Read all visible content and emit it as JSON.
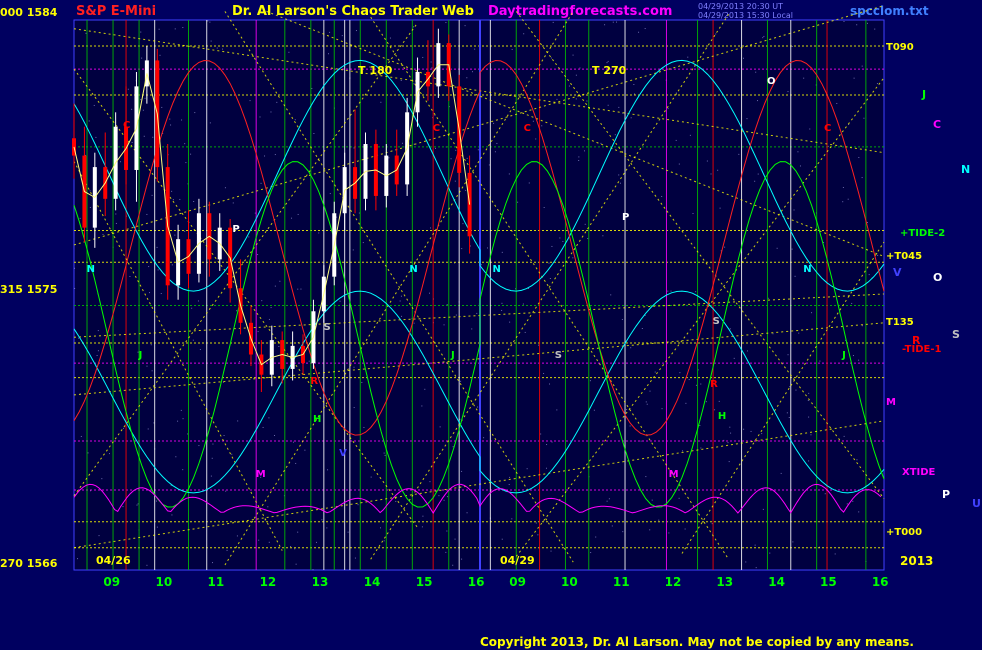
{
  "header": {
    "instrument": "S&P E-Mini",
    "site": "Dr. Al Larson's Chaos Trader Web",
    "url": "Daytradingforecasts.com",
    "timestamp_1": "04/29/2013 20:30 UT",
    "timestamp_2": "04/29/2013 15:30 Local",
    "file": "spcclom.txt"
  },
  "footer": {
    "copyright": "Copyright 2013, Dr. Al Larson. May not be copied by any means."
  },
  "price_labels": {
    "top": "000  1584",
    "mid": "315  1575",
    "bottom": "270  1566"
  },
  "colors": {
    "background": "#000060",
    "plot_background": "#000040",
    "grid_green": "#00c000",
    "yellow": "#ffff00",
    "red": "#ff0000",
    "cyan": "#00ffff",
    "green": "#00ff00",
    "magenta": "#ff00ff",
    "white": "#ffffff"
  },
  "chart_data": {
    "type": "candlestick",
    "title": "S&P E-Mini",
    "yrange": [
      1566,
      1584
    ],
    "y_ticks": [
      1584,
      1575,
      1566
    ],
    "date_markers": [
      "04/26",
      "04/29"
    ],
    "x_ticks": [
      "09",
      "10",
      "11",
      "12",
      "13",
      "14",
      "15",
      "16",
      "09",
      "10",
      "11",
      "12",
      "13",
      "14",
      "15",
      "16"
    ],
    "year": "2013",
    "top_labels": [
      {
        "text": "T  180"
      },
      {
        "text": "T  270"
      }
    ],
    "right_labels": [
      {
        "text": "T090",
        "color": "#ffff00"
      },
      {
        "text": "+TIDE-2",
        "color": "#00ff00"
      },
      {
        "text": "+T045",
        "color": "#ffff00"
      },
      {
        "text": "T135",
        "color": "#ffff00"
      },
      {
        "text": "-TIDE-1",
        "color": "#ff0000"
      },
      {
        "text": "M",
        "color": "#ff00ff"
      },
      {
        "text": "XTIDE",
        "color": "#ff00ff"
      },
      {
        "text": "+T000",
        "color": "#ffff00"
      }
    ],
    "planet_legend": [
      {
        "text": "J",
        "color": "#00ff00"
      },
      {
        "text": "C",
        "color": "#ff00ff"
      },
      {
        "text": "N",
        "color": "#00ffff"
      },
      {
        "text": "V",
        "color": "#4040ff"
      },
      {
        "text": "O",
        "color": "#ffffff"
      },
      {
        "text": "S",
        "color": "#c0c0c0"
      },
      {
        "text": "R",
        "color": "#ff0000"
      },
      {
        "text": "P",
        "color": "#ffffff"
      },
      {
        "text": "U",
        "color": "#4040ff"
      }
    ],
    "inplot_markers": [
      {
        "text": "C",
        "color": "#ff0000",
        "day": 1,
        "hour": 9.3,
        "price": 1581.2
      },
      {
        "text": "N",
        "color": "#00ffff",
        "day": 1,
        "hour": 8.6,
        "price": 1576.2
      },
      {
        "text": "P",
        "color": "#ffffff",
        "day": 1,
        "hour": 11.4,
        "price": 1577.6
      },
      {
        "text": "J",
        "color": "#00ff00",
        "day": 1,
        "hour": 9.6,
        "price": 1573.2
      },
      {
        "text": "S",
        "color": "#c0c0c0",
        "day": 1,
        "hour": 13.15,
        "price": 1574.2
      },
      {
        "text": "R",
        "color": "#ff0000",
        "day": 1,
        "hour": 12.9,
        "price": 1572.3
      },
      {
        "text": "H",
        "color": "#00ff00",
        "day": 1,
        "hour": 12.95,
        "price": 1571.0
      },
      {
        "text": "V",
        "color": "#4040ff",
        "day": 1,
        "hour": 13.45,
        "price": 1569.8
      },
      {
        "text": "M",
        "color": "#ff00ff",
        "day": 1,
        "hour": 11.85,
        "price": 1569.1
      },
      {
        "text": "N",
        "color": "#00ffff",
        "day": 1,
        "hour": 14.8,
        "price": 1576.2
      },
      {
        "text": "C",
        "color": "#ff0000",
        "day": 1,
        "hour": 15.25,
        "price": 1581.1
      },
      {
        "text": "J",
        "color": "#00ff00",
        "day": 1,
        "hour": 15.6,
        "price": 1573.2
      },
      {
        "text": "N",
        "color": "#00ffff",
        "day": 2,
        "hour": 8.6,
        "price": 1576.2
      },
      {
        "text": "C",
        "color": "#ff0000",
        "day": 2,
        "hour": 9.2,
        "price": 1581.1
      },
      {
        "text": "P",
        "color": "#ffffff",
        "day": 2,
        "hour": 11.1,
        "price": 1578.0
      },
      {
        "text": "S",
        "color": "#c0c0c0",
        "day": 2,
        "hour": 9.8,
        "price": 1573.2
      },
      {
        "text": "O",
        "color": "#ffffff",
        "day": 2,
        "hour": 13.9,
        "price": 1582.7
      },
      {
        "text": "S",
        "color": "#c0c0c0",
        "day": 2,
        "hour": 12.85,
        "price": 1574.4
      },
      {
        "text": "R",
        "color": "#ff0000",
        "day": 2,
        "hour": 12.8,
        "price": 1572.2
      },
      {
        "text": "H",
        "color": "#00ff00",
        "day": 2,
        "hour": 12.95,
        "price": 1571.1
      },
      {
        "text": "M",
        "color": "#ff00ff",
        "day": 2,
        "hour": 12.0,
        "price": 1569.1
      },
      {
        "text": "N",
        "color": "#00ffff",
        "day": 2,
        "hour": 14.6,
        "price": 1576.2
      },
      {
        "text": "C",
        "color": "#ff0000",
        "day": 2,
        "hour": 15.0,
        "price": 1581.1
      },
      {
        "text": "J",
        "color": "#00ff00",
        "day": 2,
        "hour": 15.35,
        "price": 1573.2
      }
    ],
    "vertical_lines": [
      {
        "day": 1,
        "hour": 8.55,
        "color": "#00c000"
      },
      {
        "day": 1,
        "hour": 9.05,
        "color": "#00c000"
      },
      {
        "day": 1,
        "hour": 9.3,
        "color": "#ff0000"
      },
      {
        "day": 1,
        "hour": 9.55,
        "color": "#00c000"
      },
      {
        "day": 1,
        "hour": 9.85,
        "color": "#ffffff"
      },
      {
        "day": 1,
        "hour": 10.5,
        "color": "#00c000"
      },
      {
        "day": 1,
        "hour": 10.85,
        "color": "#ffffff"
      },
      {
        "day": 1,
        "hour": 11.8,
        "color": "#ff00ff"
      },
      {
        "day": 1,
        "hour": 12.35,
        "color": "#00c000"
      },
      {
        "day": 1,
        "hour": 12.85,
        "color": "#00c000"
      },
      {
        "day": 1,
        "hour": 13.1,
        "color": "#ffffff"
      },
      {
        "day": 1,
        "hour": 13.3,
        "color": "#00c000"
      },
      {
        "day": 1,
        "hour": 13.5,
        "color": "#ffffff"
      },
      {
        "day": 1,
        "hour": 13.6,
        "color": "#ffffff"
      },
      {
        "day": 1,
        "hour": 13.8,
        "color": "#00c000"
      },
      {
        "day": 1,
        "hour": 14.3,
        "color": "#00c000"
      },
      {
        "day": 1,
        "hour": 14.8,
        "color": "#00c000"
      },
      {
        "day": 1,
        "hour": 15.2,
        "color": "#ff0000"
      },
      {
        "day": 1,
        "hour": 15.5,
        "color": "#00c000"
      },
      {
        "day": 1,
        "hour": 15.7,
        "color": "#ffffff"
      },
      {
        "day": 2,
        "hour": 8.5,
        "color": "#ffffff"
      },
      {
        "day": 2,
        "hour": 9.0,
        "color": "#00c000"
      },
      {
        "day": 2,
        "hour": 9.45,
        "color": "#ff0000"
      },
      {
        "day": 2,
        "hour": 9.95,
        "color": "#00c000"
      },
      {
        "day": 2,
        "hour": 10.4,
        "color": "#00c000"
      },
      {
        "day": 2,
        "hour": 11.1,
        "color": "#ffffff"
      },
      {
        "day": 2,
        "hour": 11.9,
        "color": "#ff00ff"
      },
      {
        "day": 2,
        "hour": 12.5,
        "color": "#00c000"
      },
      {
        "day": 2,
        "hour": 12.8,
        "color": "#ff0000"
      },
      {
        "day": 2,
        "hour": 13.35,
        "color": "#ffffff"
      },
      {
        "day": 2,
        "hour": 13.85,
        "color": "#00c000"
      },
      {
        "day": 2,
        "hour": 14.3,
        "color": "#ffffff"
      },
      {
        "day": 2,
        "hour": 14.8,
        "color": "#00c000"
      },
      {
        "day": 2,
        "hour": 15.0,
        "color": "#ff0000"
      },
      {
        "day": 2,
        "hour": 15.75,
        "color": "#00c000"
      }
    ],
    "horizontal_lines": [
      {
        "price": 1584.0,
        "color": "#ffff00"
      },
      {
        "price": 1583.2,
        "color": "#ff00ff"
      },
      {
        "price": 1582.3,
        "color": "#ffff00"
      },
      {
        "price": 1580.5,
        "color": "#00c000"
      },
      {
        "price": 1577.6,
        "color": "#ffff00"
      },
      {
        "price": 1576.5,
        "color": "#ffff00"
      },
      {
        "price": 1575.0,
        "color": "#00c000"
      },
      {
        "price": 1573.7,
        "color": "#ffff00"
      },
      {
        "price": 1573.0,
        "color": "#ff00ff"
      },
      {
        "price": 1572.5,
        "color": "#ffff00"
      },
      {
        "price": 1570.3,
        "color": "#ff00ff"
      },
      {
        "price": 1568.6,
        "color": "#ff00ff"
      },
      {
        "price": 1567.5,
        "color": "#ffff00"
      },
      {
        "price": 1566.6,
        "color": "#ffff00"
      }
    ],
    "diagonals": [
      {
        "from": [
          1,
          8.3,
          1584.6
        ],
        "to": [
          2,
          16.1,
          1580.3
        ]
      },
      {
        "from": [
          1,
          8.3,
          1577.1
        ],
        "to": [
          2,
          16.1,
          1585.4
        ]
      },
      {
        "from": [
          1,
          8.3,
          1583.2
        ],
        "to": [
          1,
          14.9,
          1567.3
        ]
      },
      {
        "from": [
          1,
          8.3,
          1568.4
        ],
        "to": [
          1,
          14.9,
          1584.8
        ]
      },
      {
        "from": [
          1,
          11.2,
          1585.2
        ],
        "to": [
          2,
          10.1,
          1566.1
        ]
      },
      {
        "from": [
          1,
          11.2,
          1566.0
        ],
        "to": [
          2,
          10.1,
          1585.2
        ]
      },
      {
        "from": [
          1,
          14.0,
          1585.0
        ],
        "to": [
          2,
          13.1,
          1566.2
        ]
      },
      {
        "from": [
          1,
          14.0,
          1566.2
        ],
        "to": [
          2,
          13.1,
          1585.1
        ]
      },
      {
        "from": [
          2,
          9.0,
          1585.2
        ],
        "to": [
          2,
          16.1,
          1568.3
        ]
      },
      {
        "from": [
          2,
          9.0,
          1566.3
        ],
        "to": [
          2,
          16.1,
          1582.9
        ]
      },
      {
        "from": [
          1,
          8.3,
          1573.9
        ],
        "to": [
          2,
          16.1,
          1575.4
        ]
      },
      {
        "from": [
          1,
          8.3,
          1571.9
        ],
        "to": [
          2,
          16.1,
          1574.4
        ]
      },
      {
        "from": [
          1,
          8.3,
          1580.0
        ],
        "to": [
          1,
          12.3,
          1566.5
        ]
      },
      {
        "from": [
          1,
          12.0,
          1585.2
        ],
        "to": [
          2,
          16.1,
          1576.7
        ]
      },
      {
        "from": [
          1,
          8.3,
          1566.6
        ],
        "to": [
          2,
          16.1,
          1571.0
        ]
      },
      {
        "from": [
          2,
          12.2,
          1566.4
        ],
        "to": [
          2,
          16.1,
          1577.2
        ]
      }
    ],
    "price_series": [
      {
        "day": 1,
        "hour": 8.3,
        "o": 1580.8,
        "h": 1582.0,
        "l": 1579.4,
        "c": 1580.2
      },
      {
        "day": 1,
        "hour": 8.5,
        "o": 1580.2,
        "h": 1581.2,
        "l": 1577.2,
        "c": 1577.7
      },
      {
        "day": 1,
        "hour": 8.7,
        "o": 1577.7,
        "h": 1580.3,
        "l": 1577.0,
        "c": 1579.8
      },
      {
        "day": 1,
        "hour": 8.9,
        "o": 1579.8,
        "h": 1581.0,
        "l": 1578.1,
        "c": 1578.7
      },
      {
        "day": 1,
        "hour": 9.1,
        "o": 1578.7,
        "h": 1581.7,
        "l": 1578.3,
        "c": 1581.2
      },
      {
        "day": 1,
        "hour": 9.3,
        "o": 1581.2,
        "h": 1582.6,
        "l": 1579.2,
        "c": 1579.7
      },
      {
        "day": 1,
        "hour": 9.5,
        "o": 1579.7,
        "h": 1583.1,
        "l": 1578.6,
        "c": 1582.6
      },
      {
        "day": 1,
        "hour": 9.7,
        "o": 1582.6,
        "h": 1584.0,
        "l": 1582.0,
        "c": 1583.5
      },
      {
        "day": 1,
        "hour": 9.9,
        "o": 1583.5,
        "h": 1583.9,
        "l": 1579.3,
        "c": 1579.8
      },
      {
        "day": 1,
        "hour": 10.1,
        "o": 1579.8,
        "h": 1580.6,
        "l": 1575.2,
        "c": 1575.7
      },
      {
        "day": 1,
        "hour": 10.3,
        "o": 1575.7,
        "h": 1577.8,
        "l": 1575.2,
        "c": 1577.3
      },
      {
        "day": 1,
        "hour": 10.5,
        "o": 1577.3,
        "h": 1578.3,
        "l": 1575.6,
        "c": 1576.1
      },
      {
        "day": 1,
        "hour": 10.7,
        "o": 1576.1,
        "h": 1578.7,
        "l": 1575.8,
        "c": 1578.2
      },
      {
        "day": 1,
        "hour": 10.9,
        "o": 1578.2,
        "h": 1578.6,
        "l": 1576.0,
        "c": 1576.6
      },
      {
        "day": 1,
        "hour": 11.1,
        "o": 1576.6,
        "h": 1578.2,
        "l": 1576.2,
        "c": 1577.7
      },
      {
        "day": 1,
        "hour": 11.3,
        "o": 1577.7,
        "h": 1578.0,
        "l": 1575.1,
        "c": 1575.6
      },
      {
        "day": 1,
        "hour": 11.5,
        "o": 1575.6,
        "h": 1576.6,
        "l": 1574.0,
        "c": 1574.4
      },
      {
        "day": 1,
        "hour": 11.7,
        "o": 1574.4,
        "h": 1575.0,
        "l": 1572.9,
        "c": 1573.3
      },
      {
        "day": 1,
        "hour": 11.9,
        "o": 1573.3,
        "h": 1573.8,
        "l": 1572.0,
        "c": 1572.6
      },
      {
        "day": 1,
        "hour": 12.1,
        "o": 1572.6,
        "h": 1574.3,
        "l": 1572.2,
        "c": 1573.8
      },
      {
        "day": 1,
        "hour": 12.3,
        "o": 1573.8,
        "h": 1574.1,
        "l": 1572.3,
        "c": 1572.8
      },
      {
        "day": 1,
        "hour": 12.5,
        "o": 1572.8,
        "h": 1574.1,
        "l": 1572.4,
        "c": 1573.6
      },
      {
        "day": 1,
        "hour": 12.7,
        "o": 1573.6,
        "h": 1574.0,
        "l": 1572.6,
        "c": 1573.0
      },
      {
        "day": 1,
        "hour": 12.9,
        "o": 1573.0,
        "h": 1575.2,
        "l": 1572.8,
        "c": 1574.8
      },
      {
        "day": 1,
        "hour": 13.1,
        "o": 1574.8,
        "h": 1576.4,
        "l": 1574.4,
        "c": 1576.0
      },
      {
        "day": 1,
        "hour": 13.3,
        "o": 1576.0,
        "h": 1578.6,
        "l": 1575.7,
        "c": 1578.2
      },
      {
        "day": 1,
        "hour": 13.5,
        "o": 1578.2,
        "h": 1580.3,
        "l": 1577.6,
        "c": 1579.8
      },
      {
        "day": 1,
        "hour": 13.7,
        "o": 1579.8,
        "h": 1581.8,
        "l": 1578.2,
        "c": 1578.7
      },
      {
        "day": 1,
        "hour": 13.9,
        "o": 1578.7,
        "h": 1581.0,
        "l": 1578.3,
        "c": 1580.6
      },
      {
        "day": 1,
        "hour": 14.1,
        "o": 1580.6,
        "h": 1581.1,
        "l": 1578.3,
        "c": 1578.8
      },
      {
        "day": 1,
        "hour": 14.3,
        "o": 1578.8,
        "h": 1580.6,
        "l": 1578.4,
        "c": 1580.2
      },
      {
        "day": 1,
        "hour": 14.5,
        "o": 1580.2,
        "h": 1581.1,
        "l": 1578.8,
        "c": 1579.2
      },
      {
        "day": 1,
        "hour": 14.7,
        "o": 1579.2,
        "h": 1582.2,
        "l": 1578.8,
        "c": 1581.7
      },
      {
        "day": 1,
        "hour": 14.9,
        "o": 1581.7,
        "h": 1583.6,
        "l": 1581.2,
        "c": 1583.1
      },
      {
        "day": 1,
        "hour": 15.1,
        "o": 1583.1,
        "h": 1584.2,
        "l": 1582.1,
        "c": 1582.6
      },
      {
        "day": 1,
        "hour": 15.3,
        "o": 1582.6,
        "h": 1584.6,
        "l": 1582.2,
        "c": 1584.1
      },
      {
        "day": 1,
        "hour": 15.5,
        "o": 1584.1,
        "h": 1584.4,
        "l": 1582.1,
        "c": 1582.6
      },
      {
        "day": 1,
        "hour": 15.7,
        "o": 1582.6,
        "h": 1583.0,
        "l": 1579.1,
        "c": 1579.6
      },
      {
        "day": 1,
        "hour": 15.9,
        "o": 1579.6,
        "h": 1580.2,
        "l": 1576.8,
        "c": 1577.4
      }
    ]
  }
}
